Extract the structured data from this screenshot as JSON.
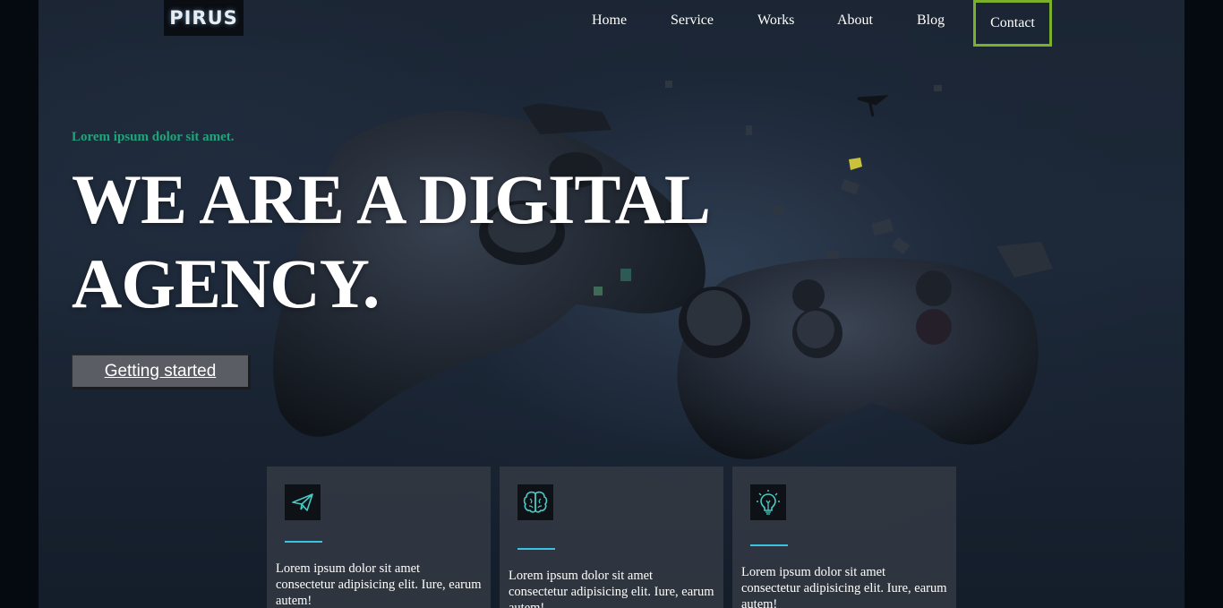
{
  "brand": {
    "logo_text": "PIRUS"
  },
  "nav": {
    "items": [
      "Home",
      "Service",
      "Works",
      "About",
      "Blog"
    ],
    "contact_label": "Contact"
  },
  "hero": {
    "eyebrow": "Lorem ipsum dolor sit amet.",
    "headline_line1": "WE ARE A DIGITAL",
    "headline_line2": "AGENCY.",
    "cta_label": "Getting started",
    "background_image": "exploding game controller"
  },
  "cards": [
    {
      "icon": "paper-plane-icon",
      "text": "Lorem ipsum dolor sit amet consectetur adipisicing elit. Iure, earum autem!"
    },
    {
      "icon": "brain-icon",
      "text": "Lorem ipsum dolor sit amet consectetur adipisicing elit. Iure, earum autem!"
    },
    {
      "icon": "lightbulb-icon",
      "text": "Lorem ipsum dolor sit amet consectetur adipisicing elit. Iure, earum autem!"
    }
  ],
  "colors": {
    "accent_green": "#21a37b",
    "contact_border": "#7bb12a",
    "card_line": "#39c3e0",
    "icon_teal": "#49c9c3"
  }
}
